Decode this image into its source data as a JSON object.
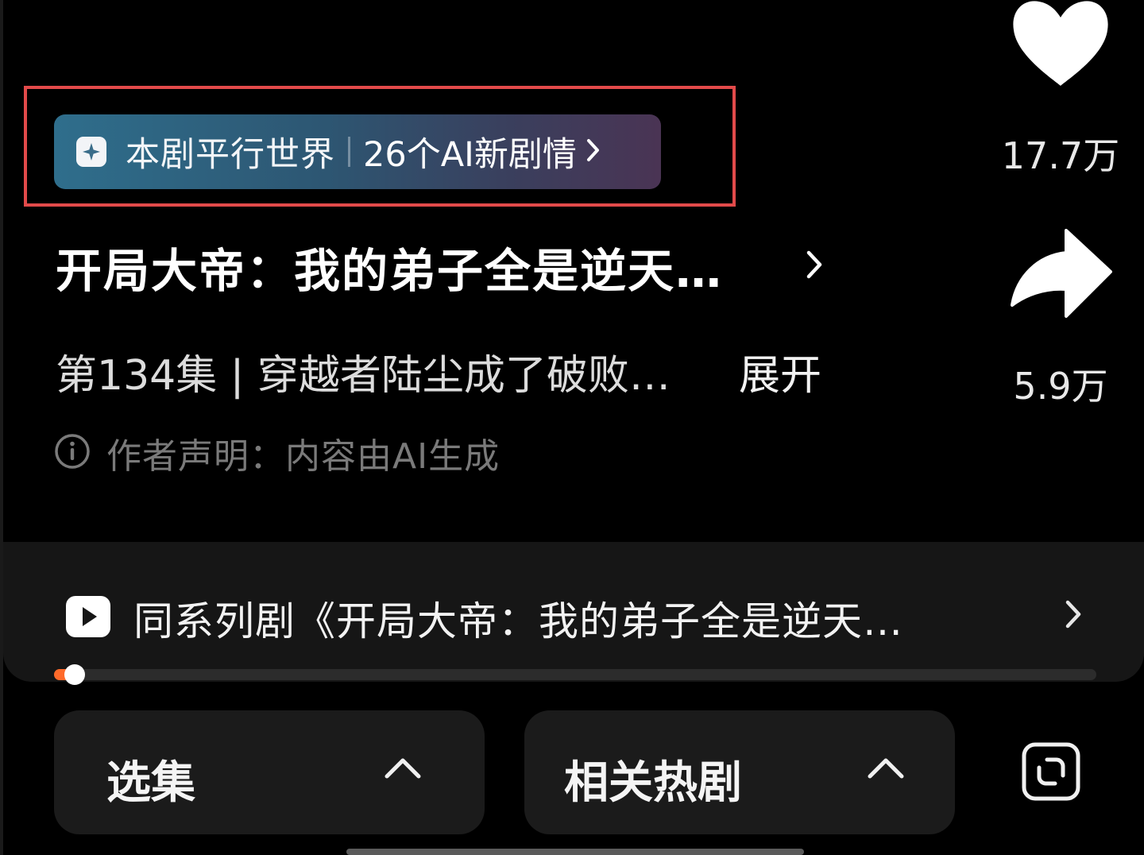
{
  "ai_banner": {
    "label": "本剧平行世界",
    "highlight": "26个AI新剧情"
  },
  "drama": {
    "title": "开局大帝：我的弟子全是逆天…",
    "episode_desc": "第134集 | 穿越者陆尘成了破败…",
    "expand_label": "展开",
    "author_statement": "作者声明：内容由AI生成"
  },
  "actions": {
    "like_count": "17.7万",
    "share_count": "5.9万"
  },
  "series": {
    "label": "同系列剧《开局大帝：我的弟子全是逆天…",
    "progress": 0.02
  },
  "bottom_bar": {
    "episodes_label": "选集",
    "related_label": "相关热剧"
  },
  "colors": {
    "highlight_border": "#e24a4a",
    "progress_fill": "#ff6a2a",
    "background": "#000000"
  },
  "icons": {
    "sparkle": "sparkle-icon",
    "like": "heart-icon",
    "share": "share-arrow-icon",
    "info": "info-icon",
    "play": "play-icon",
    "chevron": "chevron-right-icon",
    "caret_up": "chevron-up-icon",
    "fullscreen": "fullscreen-icon"
  }
}
